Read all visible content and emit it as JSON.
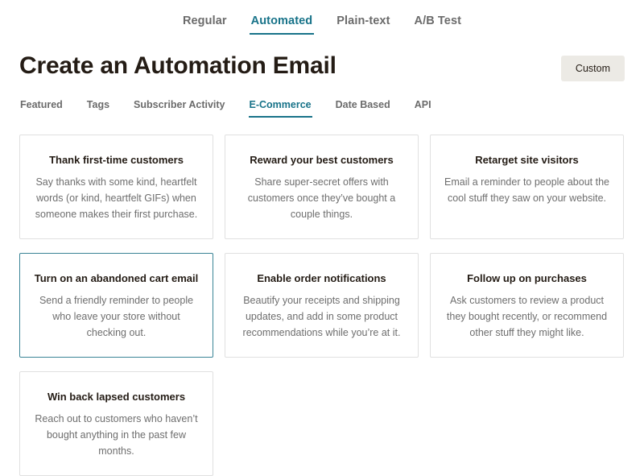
{
  "type_tabs": {
    "items": [
      {
        "label": "Regular",
        "active": false
      },
      {
        "label": "Automated",
        "active": true
      },
      {
        "label": "Plain-text",
        "active": false
      },
      {
        "label": "A/B Test",
        "active": false
      }
    ]
  },
  "header": {
    "title": "Create an Automation Email",
    "custom_button_label": "Custom"
  },
  "category_tabs": {
    "items": [
      {
        "label": "Featured",
        "active": false
      },
      {
        "label": "Tags",
        "active": false
      },
      {
        "label": "Subscriber Activity",
        "active": false
      },
      {
        "label": "E-Commerce",
        "active": true
      },
      {
        "label": "Date Based",
        "active": false
      },
      {
        "label": "API",
        "active": false
      }
    ]
  },
  "cards": [
    {
      "title": "Thank first-time customers",
      "description": "Say thanks with some kind, heartfelt words (or kind, heartfelt GIFs) when someone makes their first purchase.",
      "selected": false
    },
    {
      "title": "Reward your best customers",
      "description": "Share super-secret offers with customers once they’ve bought a couple things.",
      "selected": false
    },
    {
      "title": "Retarget site visitors",
      "description": "Email a reminder to people about the cool stuff they saw on your website.",
      "selected": false
    },
    {
      "title": "Turn on an abandoned cart email",
      "description": "Send a friendly reminder to people who leave your store without checking out.",
      "selected": true
    },
    {
      "title": "Enable order notifications",
      "description": "Beautify your receipts and shipping updates, and add in some product recommendations while you’re at it.",
      "selected": false
    },
    {
      "title": "Follow up on purchases",
      "description": "Ask customers to review a product they bought recently, or recommend other stuff they might like.",
      "selected": false
    },
    {
      "title": "Win back lapsed customers",
      "description": "Reach out to customers who haven’t bought anything in the past few months.",
      "selected": false
    }
  ],
  "colors": {
    "accent_teal": "#187389",
    "selected_border": "#3a8496",
    "card_border": "#e0e0e0",
    "title_text": "#241c15",
    "muted_text": "#6b6b6b",
    "button_bg": "#eceae5"
  }
}
